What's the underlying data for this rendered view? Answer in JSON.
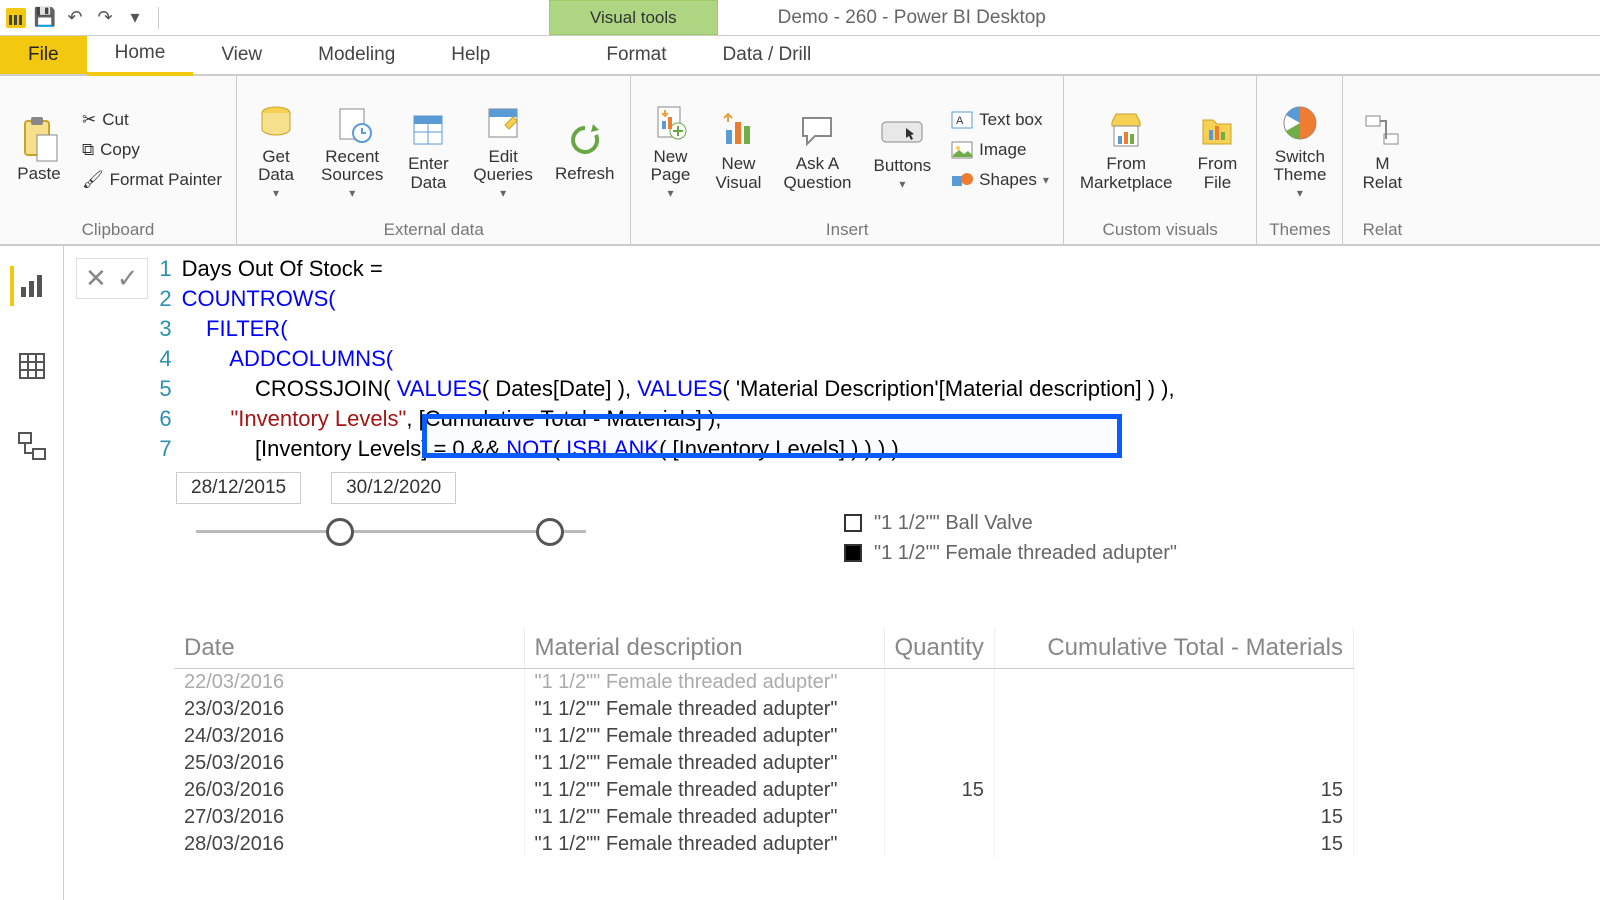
{
  "window": {
    "context_tool": "Visual tools",
    "title": "Demo - 260 - Power BI Desktop"
  },
  "tabs": {
    "file": "File",
    "home": "Home",
    "view": "View",
    "modeling": "Modeling",
    "help": "Help",
    "format": "Format",
    "datadrill": "Data / Drill"
  },
  "ribbon": {
    "clipboard": {
      "label": "Clipboard",
      "paste": "Paste",
      "cut": "Cut",
      "copy": "Copy",
      "painter": "Format Painter"
    },
    "external": {
      "label": "External data",
      "get": "Get\nData",
      "recent": "Recent\nSources",
      "enter": "Enter\nData",
      "edit": "Edit\nQueries",
      "refresh": "Refresh"
    },
    "insert": {
      "label": "Insert",
      "newpage": "New\nPage",
      "newvisual": "New\nVisual",
      "ask": "Ask A\nQuestion",
      "buttons": "Buttons",
      "textbox": "Text box",
      "image": "Image",
      "shapes": "Shapes"
    },
    "custom": {
      "label": "Custom visuals",
      "market": "From\nMarketplace",
      "file": "From\nFile"
    },
    "themes": {
      "label": "Themes",
      "switch": "Switch\nTheme"
    },
    "rel": {
      "label": "Relat",
      "btn": "M\nRelat"
    }
  },
  "formula": {
    "l1": "Days Out Of Stock =",
    "l2": "COUNTROWS(",
    "l3": "    FILTER(",
    "l4": "        ADDCOLUMNS(",
    "l5_a": "            CROSSJOIN( ",
    "l5_b": "VALUES",
    "l5_c": "( Dates[Date] ), ",
    "l5_d": "VALUES",
    "l5_e": "( 'Material Description'[Material description] ) ),",
    "l6_a": "        ",
    "l6_b": "\"Inventory Levels\"",
    "l6_c": ", ",
    "l6_d": "[Cumulative Total - Materials]",
    "l6_e": " ),",
    "l7_a": "            [Inventory Levels] = 0 && ",
    "l7_b": "NOT",
    "l7_c": "( ",
    "l7_d": "ISBLANK",
    "l7_e": "( [Inventory Levels] ) ) ) )"
  },
  "slicer": {
    "start": "28/12/2015",
    "end": "30/12/2020"
  },
  "legend": {
    "item1": "\"1 1/2\"\" Ball Valve",
    "item2": "\"1 1/2\"\" Female threaded adupter\""
  },
  "table": {
    "cols": {
      "date": "Date",
      "mat": "Material description",
      "qty": "Quantity",
      "cum": "Cumulative Total - Materials"
    },
    "rows": [
      {
        "date": "22/03/2016",
        "mat": "\"1 1/2\"\" Female threaded adupter\"",
        "qty": "",
        "cum": "",
        "cut": true
      },
      {
        "date": "23/03/2016",
        "mat": "\"1 1/2\"\" Female threaded adupter\"",
        "qty": "",
        "cum": ""
      },
      {
        "date": "24/03/2016",
        "mat": "\"1 1/2\"\" Female threaded adupter\"",
        "qty": "",
        "cum": ""
      },
      {
        "date": "25/03/2016",
        "mat": "\"1 1/2\"\" Female threaded adupter\"",
        "qty": "",
        "cum": ""
      },
      {
        "date": "26/03/2016",
        "mat": "\"1 1/2\"\" Female threaded adupter\"",
        "qty": "15",
        "cum": "15"
      },
      {
        "date": "27/03/2016",
        "mat": "\"1 1/2\"\" Female threaded adupter\"",
        "qty": "",
        "cum": "15"
      },
      {
        "date": "28/03/2016",
        "mat": "\"1 1/2\"\" Female threaded adupter\"",
        "qty": "",
        "cum": "15"
      }
    ]
  }
}
